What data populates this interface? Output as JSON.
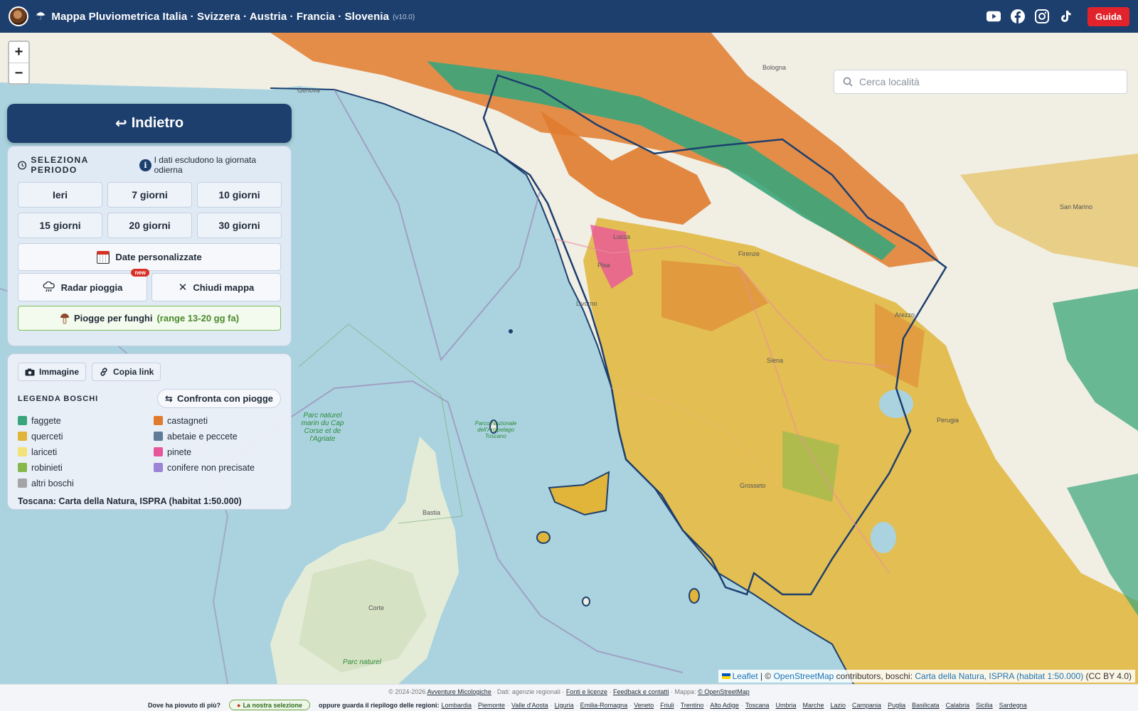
{
  "header": {
    "title": "Mappa Pluviometrica Italia · Svizzera · Austria · Francia · Slovenia",
    "version": "(v10.0)",
    "guide_label": "Guida",
    "social_icons": [
      "youtube-icon",
      "facebook-icon",
      "instagram-icon",
      "tiktok-icon"
    ]
  },
  "map": {
    "zoom_in": "+",
    "zoom_out": "−",
    "search_placeholder": "Cerca località",
    "labels": {
      "genova": "Genova",
      "bologna": "Bologna",
      "firenze": "Firenze",
      "pisa": "Pisa",
      "livorno": "Livorno",
      "lucca": "Lucca",
      "siena": "Siena",
      "arezzo": "Arezzo",
      "perugia": "Perugia",
      "grosseto": "Grosseto",
      "san_marino": "San Marino",
      "bastia": "Bastia",
      "corte": "Corte"
    },
    "parks": {
      "cap_corse": "Parc naturel marin du Cap Corse et de l'Agriate",
      "arcipelago": "Parco Nazionale dell'Arcipelago Toscano",
      "corse": "Parc naturel"
    }
  },
  "panel": {
    "back_label": "Indietro",
    "period_title": "SELEZIONA PERIODO",
    "period_note": "I dati escludono la giornata odierna",
    "periods": [
      "Ieri",
      "7 giorni",
      "10 giorni",
      "15 giorni",
      "20 giorni",
      "30 giorni"
    ],
    "custom_dates": "Date personalizzate",
    "radar": "Radar pioggia",
    "new_badge": "new",
    "close_map": "Chiudi mappa",
    "funghi": "Piogge per funghi",
    "funghi_range": "(range 13-20 gg fa)"
  },
  "legend": {
    "image_btn": "Immagine",
    "copy_link_btn": "Copia link",
    "title": "LEGENDA BOSCHI",
    "compare_btn": "Confronta con piogge",
    "items": [
      {
        "label": "faggete",
        "color": "#3aa57a"
      },
      {
        "label": "castagneti",
        "color": "#e07b2e"
      },
      {
        "label": "querceti",
        "color": "#e0b53a"
      },
      {
        "label": "abetaie e peccete",
        "color": "#5f7b97"
      },
      {
        "label": "lariceti",
        "color": "#f3e27a"
      },
      {
        "label": "pinete",
        "color": "#e8569a"
      },
      {
        "label": "robinieti",
        "color": "#86b84a"
      },
      {
        "label": "conifere non precisate",
        "color": "#9b83d6"
      },
      {
        "label": "altri boschi",
        "color": "#a4a4a4"
      }
    ],
    "source": "Toscana: Carta della Natura, ISPRA (habitat 1:50.000)"
  },
  "attribution": {
    "leaflet": "Leaflet",
    "sep": " | © ",
    "osm": "OpenStreetMap",
    "middle": " contributors, boschi: ",
    "carta": "Carta della Natura, ISPRA (habitat 1:50.000)",
    "license": " (CC BY 4.0)"
  },
  "footer": {
    "copyright": "© 2024-2026",
    "site": "Avventure Micologiche",
    "data_note": "· Dati: agenzie regionali ·",
    "sources": "Fonti e licenze",
    "feedback": "Feedback e contatti",
    "map_note": "· Mappa:",
    "map_osm": "© OpenStreetMap",
    "question": "Dove ha piovuto di più?",
    "selection": "La nostra selezione",
    "regions_label": "oppure guarda il riepilogo delle regioni:",
    "regions": [
      "Lombardia",
      "Piemonte",
      "Valle d'Aosta",
      "Liguria",
      "Emilia-Romagna",
      "Veneto",
      "Friuli",
      "Trentino",
      "Alto Adige",
      "Toscana",
      "Umbria",
      "Marche",
      "Lazio",
      "Campania",
      "Puglia",
      "Basilicata",
      "Calabria",
      "Sicilia",
      "Sardegna"
    ]
  }
}
